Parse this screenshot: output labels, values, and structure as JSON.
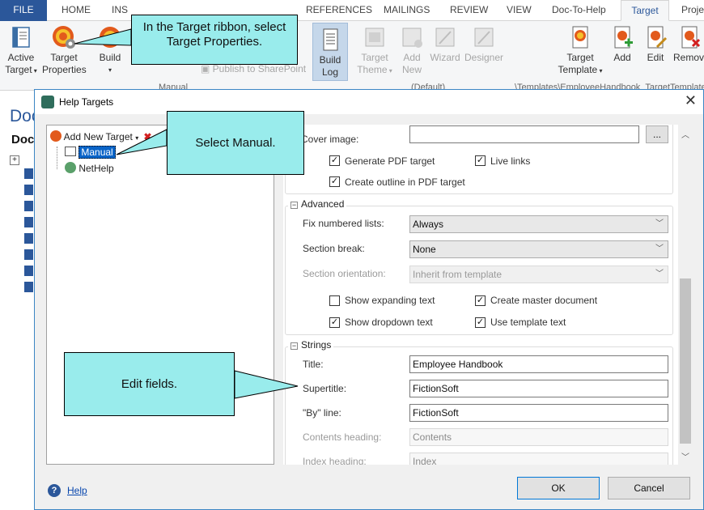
{
  "ribbon": {
    "tabs": [
      "FILE",
      "HOME",
      "INS",
      "REFERENCES",
      "MAILINGS",
      "REVIEW",
      "VIEW",
      "Doc-To-Help",
      "Target",
      "Proje"
    ],
    "buttons": {
      "active_target": [
        "Active",
        "Target"
      ],
      "target_properties": [
        "Target",
        "Properties"
      ],
      "build": "Build",
      "publish_sharepoint": "Publish to SharePoint",
      "build_log": [
        "Build",
        "Log"
      ],
      "target_theme": [
        "Target",
        "Theme"
      ],
      "add_new": [
        "Add",
        "New"
      ],
      "wizard": "Wizard",
      "designer": "Designer",
      "target_template": [
        "Target",
        "Template"
      ],
      "add": "Add",
      "edit": "Edit",
      "remove": "Remove"
    },
    "group_labels": [
      "Manual",
      "(Default)",
      "\\Templates\\EmployeeHandbook_TargetTemplate"
    ]
  },
  "doc_partial": [
    "Doc",
    "Doc"
  ],
  "dialog": {
    "title": "Help Targets",
    "add_new_target": "Add New Target",
    "tree": [
      "Manual",
      "NetHelp"
    ],
    "cover_image_label": "Cover image:",
    "cover_image_value": "",
    "browse_label": "...",
    "generate_pdf": "Generate PDF target",
    "live_links": "Live links",
    "create_outline": "Create outline in PDF target",
    "advanced": {
      "header": "Advanced",
      "fix_numbered_label": "Fix numbered lists:",
      "fix_numbered_value": "Always",
      "section_break_label": "Section break:",
      "section_break_value": "None",
      "section_orientation_label": "Section orientation:",
      "section_orientation_value": "Inherit from template",
      "show_expanding": "Show expanding text",
      "create_master": "Create master document",
      "show_dropdown": "Show dropdown text",
      "use_template_text": "Use template text"
    },
    "strings": {
      "header": "Strings",
      "title_label": "Title:",
      "title_value": "Employee Handbook",
      "supertitle_label": "Supertitle:",
      "supertitle_value": "FictionSoft",
      "by_line_label": "\"By\" line:",
      "by_line_value": "FictionSoft",
      "contents_heading_label": "Contents heading:",
      "contents_heading_value": "Contents",
      "index_heading_label": "Index heading:",
      "index_heading_value": "Index"
    },
    "help_link": "Help",
    "ok": "OK",
    "cancel": "Cancel"
  },
  "callouts": {
    "target_properties": "In the Target ribbon, select Target Properties.",
    "select_manual": "Select Manual.",
    "edit_fields": "Edit fields."
  },
  "colors": {
    "file_tab": "#2b579a",
    "callout": "#99ecec",
    "dialog_border": "#3c86c4",
    "selection": "#0a64c8"
  }
}
